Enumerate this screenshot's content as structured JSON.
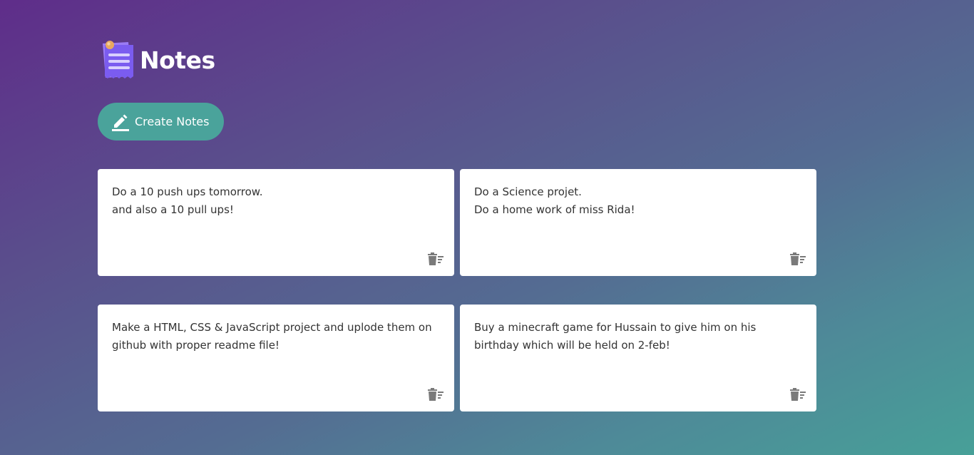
{
  "app": {
    "title": "Notes",
    "logo_icon": "notepad-icon"
  },
  "toolbar": {
    "create_label": "Create Notes",
    "create_icon": "pencil-icon"
  },
  "notes": [
    {
      "text": "Do a 10 push ups tomorrow.\nand also a 10 pull ups!",
      "delete_icon": "delete-note-icon"
    },
    {
      "text": "Do a Science projet.\nDo a home work of miss Rida!",
      "delete_icon": "delete-note-icon"
    },
    {
      "text": "Make a HTML, CSS & JavaScript project and uplode them on github with proper readme file!",
      "delete_icon": "delete-note-icon"
    },
    {
      "text": "Buy a minecraft game for Hussain to give him on his birthday which will be held on 2-feb!",
      "delete_icon": "delete-note-icon"
    }
  ],
  "colors": {
    "button_bg": "#4aa39b",
    "card_bg": "#ffffff",
    "text": "#333333",
    "icon_gray": "#7a7a7a",
    "logo_purple": "#7b5cf0"
  }
}
